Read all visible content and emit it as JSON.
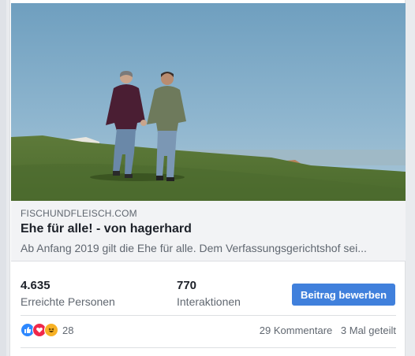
{
  "link": {
    "domain": "FISCHUNDFLEISCH.COM",
    "title": "Ehe für alle! - von hagerhard",
    "description": "Ab Anfang 2019 gilt die Ehe für alle. Dem Verfassungsgerichtshof sei..."
  },
  "stats": {
    "reach_value": "4.635",
    "reach_label": "Erreichte Personen",
    "interactions_value": "770",
    "interactions_label": "Interaktionen",
    "boost_label": "Beitrag bewerben"
  },
  "reactions": {
    "icons": [
      "like-icon",
      "love-icon",
      "haha-icon"
    ],
    "count": "28",
    "comments": "29 Kommentare",
    "shares": "3 Mal geteilt"
  },
  "colors": {
    "boost_button": "#4080dc",
    "like": "#2d88ff",
    "love": "#f0284a",
    "haha": "#f7b125"
  }
}
